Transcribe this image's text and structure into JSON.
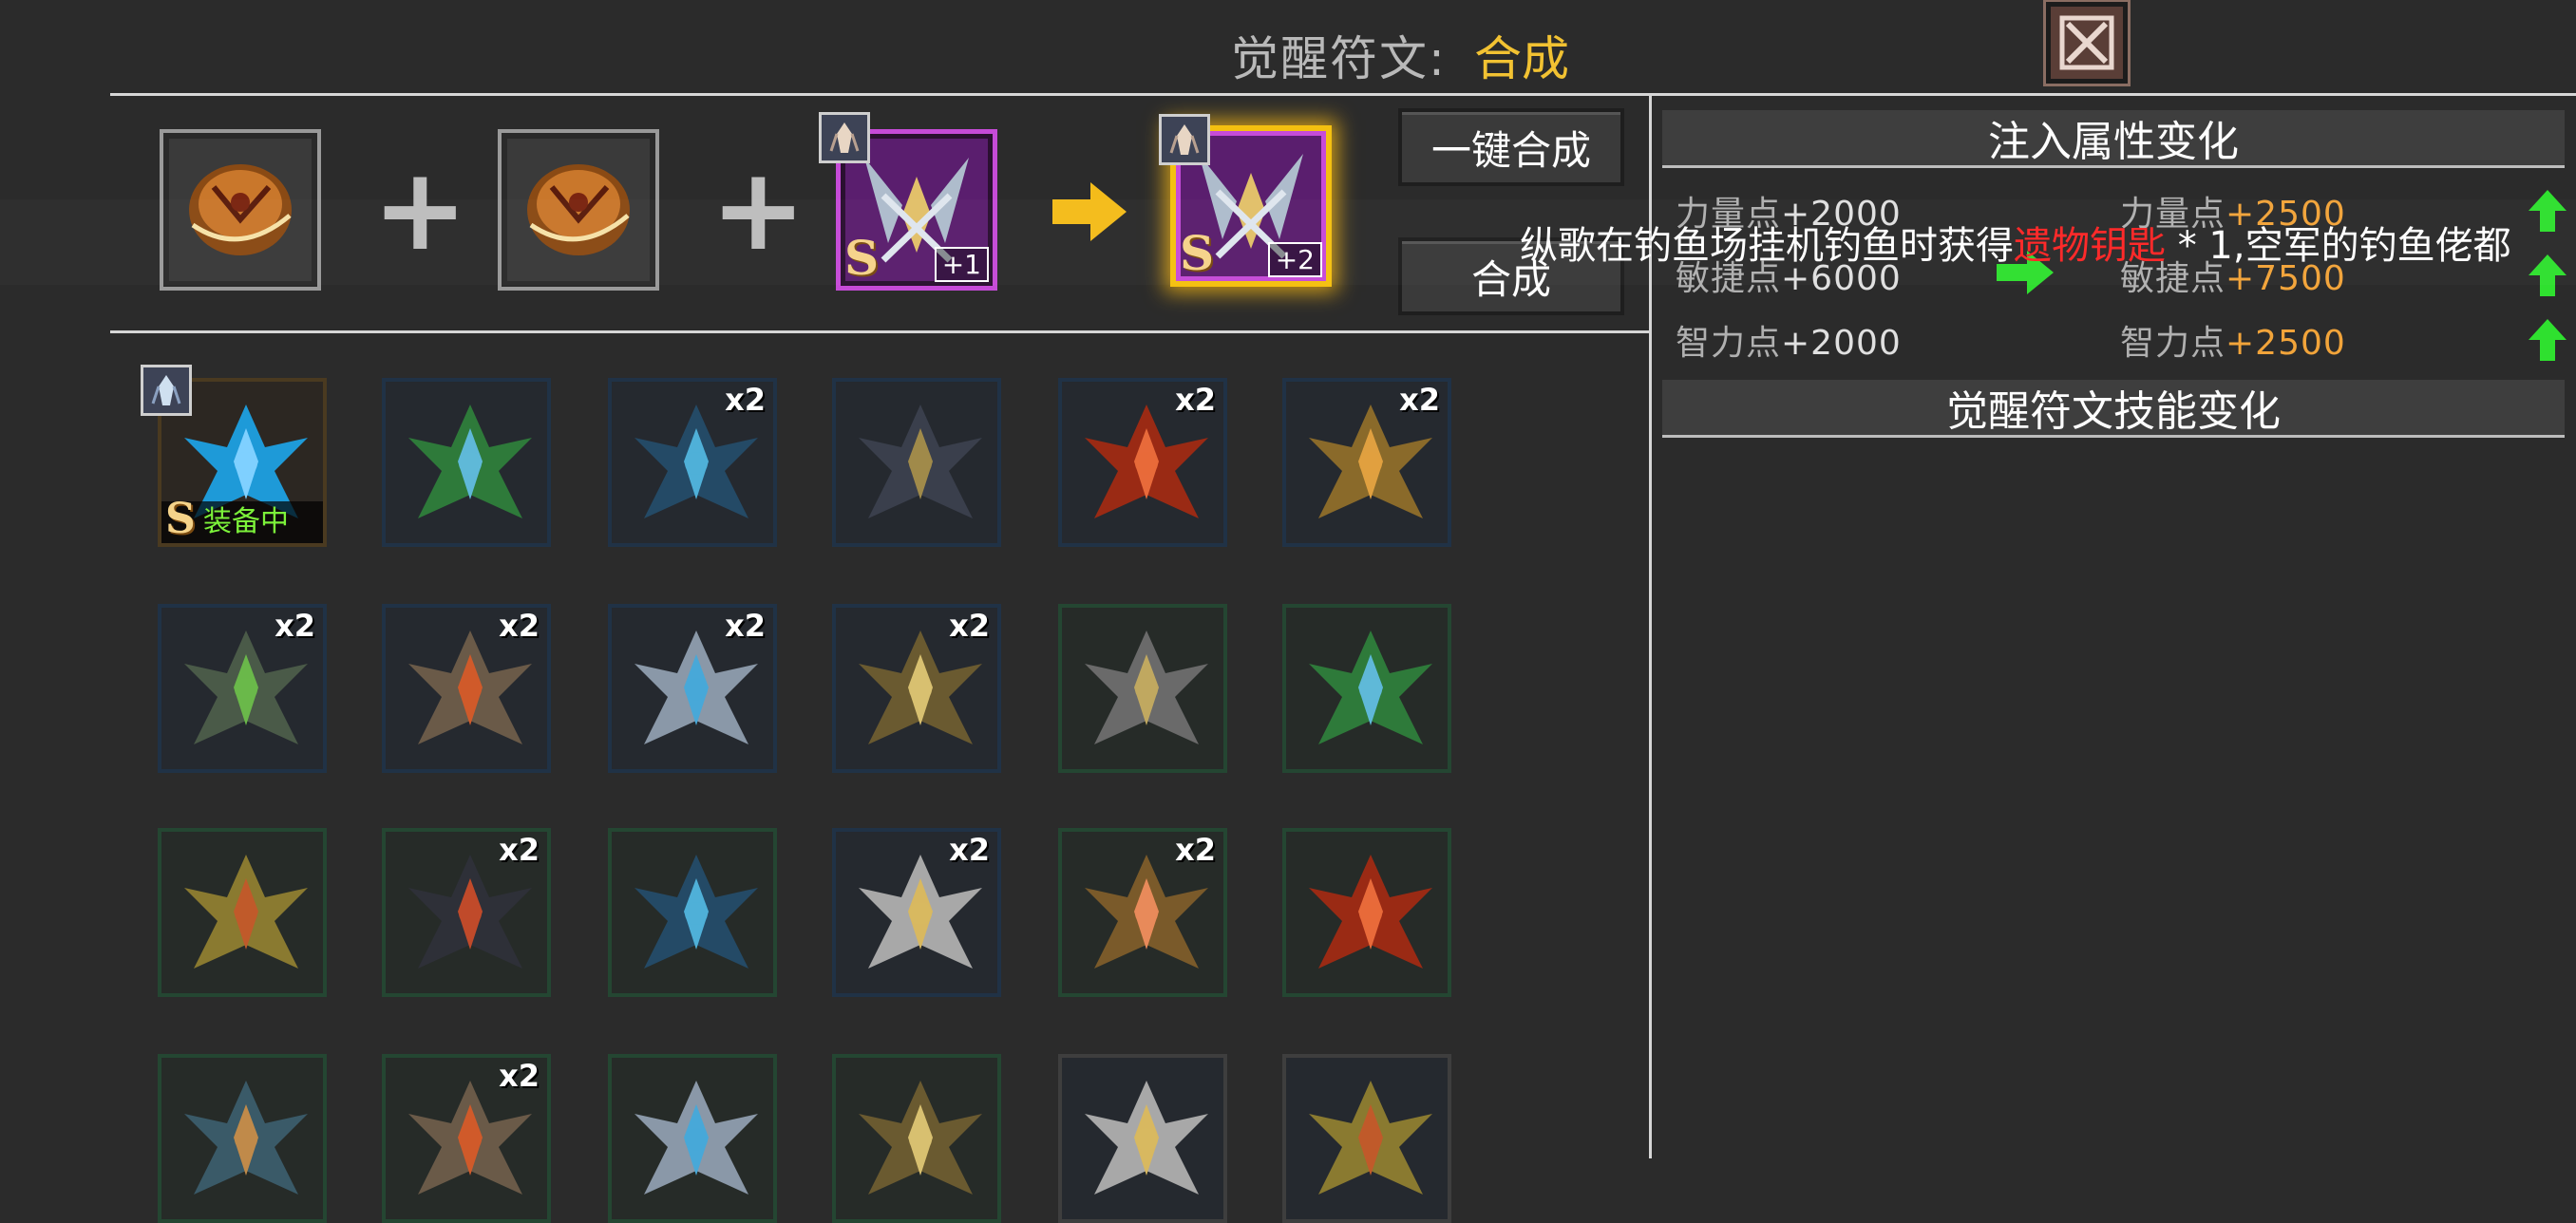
{
  "header": {
    "title_label": "觉醒符文:",
    "title_value": "合成",
    "close_icon": "close-x-icon"
  },
  "fusion": {
    "plus_1": "+",
    "plus_2": "+",
    "material_1_icon": "amber-orb-rune",
    "material_2_icon": "amber-orb-rune",
    "source_rank": "S",
    "source_level": "+1",
    "result_rank": "S",
    "result_level": "+2",
    "arrow_icon": "yellow-arrow-right-icon",
    "button_auto": "一键合成",
    "button_fuse": "合成"
  },
  "colors": {
    "accent_yellow": "#f2c232",
    "stat_orange": "#f2a43a",
    "up_green": "#2fe02f",
    "equipped_green": "#7cf23a",
    "banner_red": "#ff2a2a"
  },
  "inventory": {
    "rows": [
      [
        {
          "icon": "blue-snowflake-rune",
          "qty": "",
          "border": "equipped",
          "rank": "S",
          "status": "装备中"
        },
        {
          "icon": "green-leaf-wing-rune",
          "qty": "",
          "border": "blue"
        },
        {
          "icon": "blue-crystal-rune",
          "qty": "x2",
          "border": "blue"
        },
        {
          "icon": "dark-shield-rune",
          "qty": "",
          "border": "blue"
        },
        {
          "icon": "red-star-rune",
          "qty": "x2",
          "border": "blue"
        },
        {
          "icon": "gold-crown-rune",
          "qty": "x2",
          "border": "blue"
        }
      ],
      [
        {
          "icon": "green-armor-rune",
          "qty": "x2",
          "border": "blue"
        },
        {
          "icon": "bone-antler-rune",
          "qty": "x2",
          "border": "blue"
        },
        {
          "icon": "silver-wing-rune",
          "qty": "x2",
          "border": "blue"
        },
        {
          "icon": "gold-sword-rune",
          "qty": "x2",
          "border": "blue"
        },
        {
          "icon": "grey-star-rune",
          "qty": "",
          "border": "green"
        },
        {
          "icon": "green-leaf-wing-rune",
          "qty": "",
          "border": "green"
        }
      ],
      [
        {
          "icon": "gold-horn-rune",
          "qty": "",
          "border": "green"
        },
        {
          "icon": "dark-wolf-rune",
          "qty": "x2",
          "border": "green"
        },
        {
          "icon": "blue-crystal-rune",
          "qty": "",
          "border": "green"
        },
        {
          "icon": "white-wing-rune",
          "qty": "x2",
          "border": "blue"
        },
        {
          "icon": "gold-cross-rune",
          "qty": "x2",
          "border": "green"
        },
        {
          "icon": "red-star-rune",
          "qty": "",
          "border": "green"
        }
      ],
      [
        {
          "icon": "teal-shield-rune",
          "qty": "",
          "border": "green"
        },
        {
          "icon": "bone-antler-rune",
          "qty": "x2",
          "border": "green"
        },
        {
          "icon": "silver-wing-rune",
          "qty": "",
          "border": "green"
        },
        {
          "icon": "gold-sword-rune",
          "qty": "",
          "border": "green"
        },
        {
          "icon": "white-wing-rune",
          "qty": "",
          "border": "grey"
        },
        {
          "icon": "gold-horn-rune",
          "qty": "",
          "border": "grey"
        }
      ]
    ]
  },
  "panel": {
    "inject_title": "注入属性变化",
    "skill_title": "觉醒符文技能变化",
    "stats": [
      {
        "before_label": "力量点",
        "before_value": "+2000",
        "after_label": "力量点",
        "after_value": "+2500"
      },
      {
        "before_label": "敏捷点",
        "before_value": "+6000",
        "after_label": "敏捷点",
        "after_value": "+7500"
      },
      {
        "before_label": "智力点",
        "before_value": "+2000",
        "after_label": "智力点",
        "after_value": "+2500"
      }
    ]
  },
  "banner": {
    "text_before": "纵歌在钓鱼场挂机钓鱼时获得",
    "highlight": "遗物钥匙",
    "text_after": " * 1,空军的钓鱼佬都"
  }
}
